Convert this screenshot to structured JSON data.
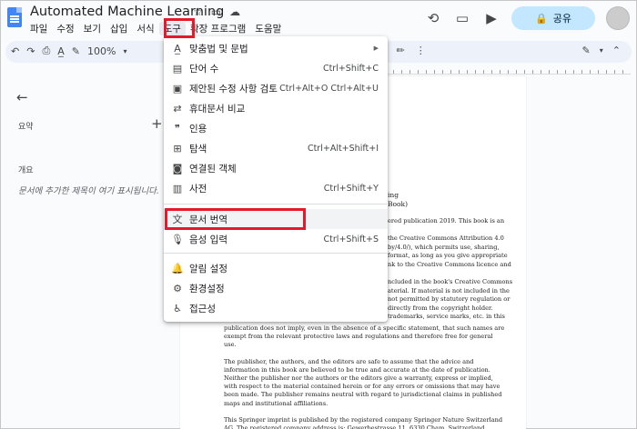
{
  "header": {
    "title": "Automated Machine Learning",
    "title_icons": [
      "star-icon",
      "folder-move-icon",
      "cloud-status-icon"
    ],
    "share_label": "공유"
  },
  "menubar": {
    "items": [
      {
        "label": "파일"
      },
      {
        "label": "수정"
      },
      {
        "label": "보기"
      },
      {
        "label": "삽입"
      },
      {
        "label": "서식"
      },
      {
        "label": "도구",
        "active": true
      },
      {
        "label": "확장 프로그램"
      },
      {
        "label": "도움말"
      }
    ]
  },
  "toolbar": {
    "zoom": "100%"
  },
  "sidebar": {
    "summary_label": "요약",
    "outline_label": "개요",
    "outline_placeholder": "문서에 추가한 제목이 여기 표시됩니다."
  },
  "tools_menu": {
    "items": [
      {
        "icon": "spellcheck-icon",
        "icon_glyph": "A̲",
        "label": "맞춤법 및 문법",
        "shortcut": "",
        "submenu": true
      },
      {
        "icon": "word-count-icon",
        "icon_glyph": "▤",
        "label": "단어 수",
        "shortcut": "Ctrl+Shift+C"
      },
      {
        "icon": "review-edits-icon",
        "icon_glyph": "▣",
        "label": "제안된 수정 사항 검토",
        "shortcut": "Ctrl+Alt+O Ctrl+Alt+U"
      },
      {
        "icon": "compare-icon",
        "icon_glyph": "⇄",
        "label": "휴대문서 비교",
        "shortcut": ""
      },
      {
        "icon": "citation-icon",
        "icon_glyph": "❞",
        "label": "인용",
        "shortcut": ""
      },
      {
        "icon": "explore-icon",
        "icon_glyph": "⊞",
        "label": "탐색",
        "shortcut": "Ctrl+Alt+Shift+I"
      },
      {
        "icon": "linked-objects-icon",
        "icon_glyph": "◙",
        "label": "연결된 객체",
        "shortcut": ""
      },
      {
        "icon": "dictionary-icon",
        "icon_glyph": "▥",
        "label": "사전",
        "shortcut": "Ctrl+Shift+Y"
      },
      {
        "icon": "translate-icon",
        "icon_glyph": "文",
        "label": "문서 번역",
        "shortcut": ""
      },
      {
        "icon": "microphone-icon",
        "icon_glyph": "🎙",
        "label": "음성 입력",
        "shortcut": "Ctrl+Shift+S"
      },
      {
        "icon": "bell-icon",
        "icon_glyph": "🔔",
        "label": "알림 설정",
        "shortcut": ""
      },
      {
        "icon": "preferences-icon",
        "icon_glyph": "⚙",
        "label": "환경설정",
        "shortcut": ""
      },
      {
        "icon": "accessibility-icon",
        "icon_glyph": "♿",
        "label": "접근성",
        "shortcut": ""
      }
    ]
  },
  "document": {
    "lines_right": [
      "ing",
      "Book)",
      "",
      "ered publication 2019. This book is an",
      "",
      "the Creative Commons Attribution 4.0",
      "by/4.0/), which permits use, sharing,",
      "format, as long as you give appropriate",
      "nk to the Creative Commons licence and",
      "",
      "ncluded in the book's Creative Commons",
      "aterial. If material is not included in the",
      "not permitted by statutory regulation or",
      "directly from the copyright holder.",
      "trademarks, service marks, etc. in this"
    ],
    "paragraphs": [
      "publication does not imply, even in the absence of a specific statement, that such names are exempt from the relevant protective laws and regulations and therefore free for general use.",
      "The publisher, the authors, and the editors are safe to assume that the advice and information in this book are believed to be true and accurate at the date of publication. Neither the publisher nor the authors or the editors give a warranty, express or implied, with respect to the material contained herein or for any errors or omissions that may have been made. The publisher remains neutral with regard to jurisdictional claims in published maps and institutional affiliations.",
      "This Springer imprint is published by the registered company Springer Nature Switzerland AG. The registered company address is: Gewerbestrasse 11, 6330 Cham, Switzerland"
    ]
  },
  "colors": {
    "highlight_red": "#e6192b",
    "share_bg": "#c2e7ff",
    "doc_blue": "#4285f4"
  }
}
